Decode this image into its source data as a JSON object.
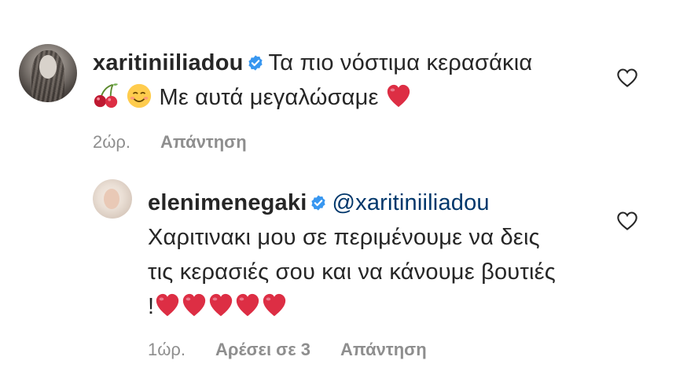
{
  "comments": [
    {
      "username": "xaritiniiliadou",
      "text_part1": "Τα πιο νόστιμα κερασάκια",
      "text_part2": "Με αυτά μεγαλώσαμε",
      "emojis": [
        "cherries-emoji",
        "smiling-face-emoji",
        "red-heart-emoji"
      ],
      "time": "2ώρ.",
      "reply_label": "Απάντηση"
    },
    {
      "username": "elenimenegaki",
      "mention": "@xaritiniiliadou",
      "text": "Χαριτινακι μου σε περιμένουμε να δεις τις κερασιές σου και να κάνουμε βουτιές !",
      "emojis": [
        "red-heart-emoji",
        "red-heart-emoji",
        "red-heart-emoji",
        "red-heart-emoji",
        "red-heart-emoji"
      ],
      "time": "1ώρ.",
      "likes_label": "Αρέσει σε 3",
      "reply_label": "Απάντηση"
    }
  ],
  "colors": {
    "text": "#262626",
    "meta": "#8e8e8e",
    "mention": "#00376b",
    "verified": "#3897f0",
    "heart": "#ed4956"
  },
  "icons": {
    "verified": "verified-badge-icon",
    "like": "heart-outline-icon"
  }
}
